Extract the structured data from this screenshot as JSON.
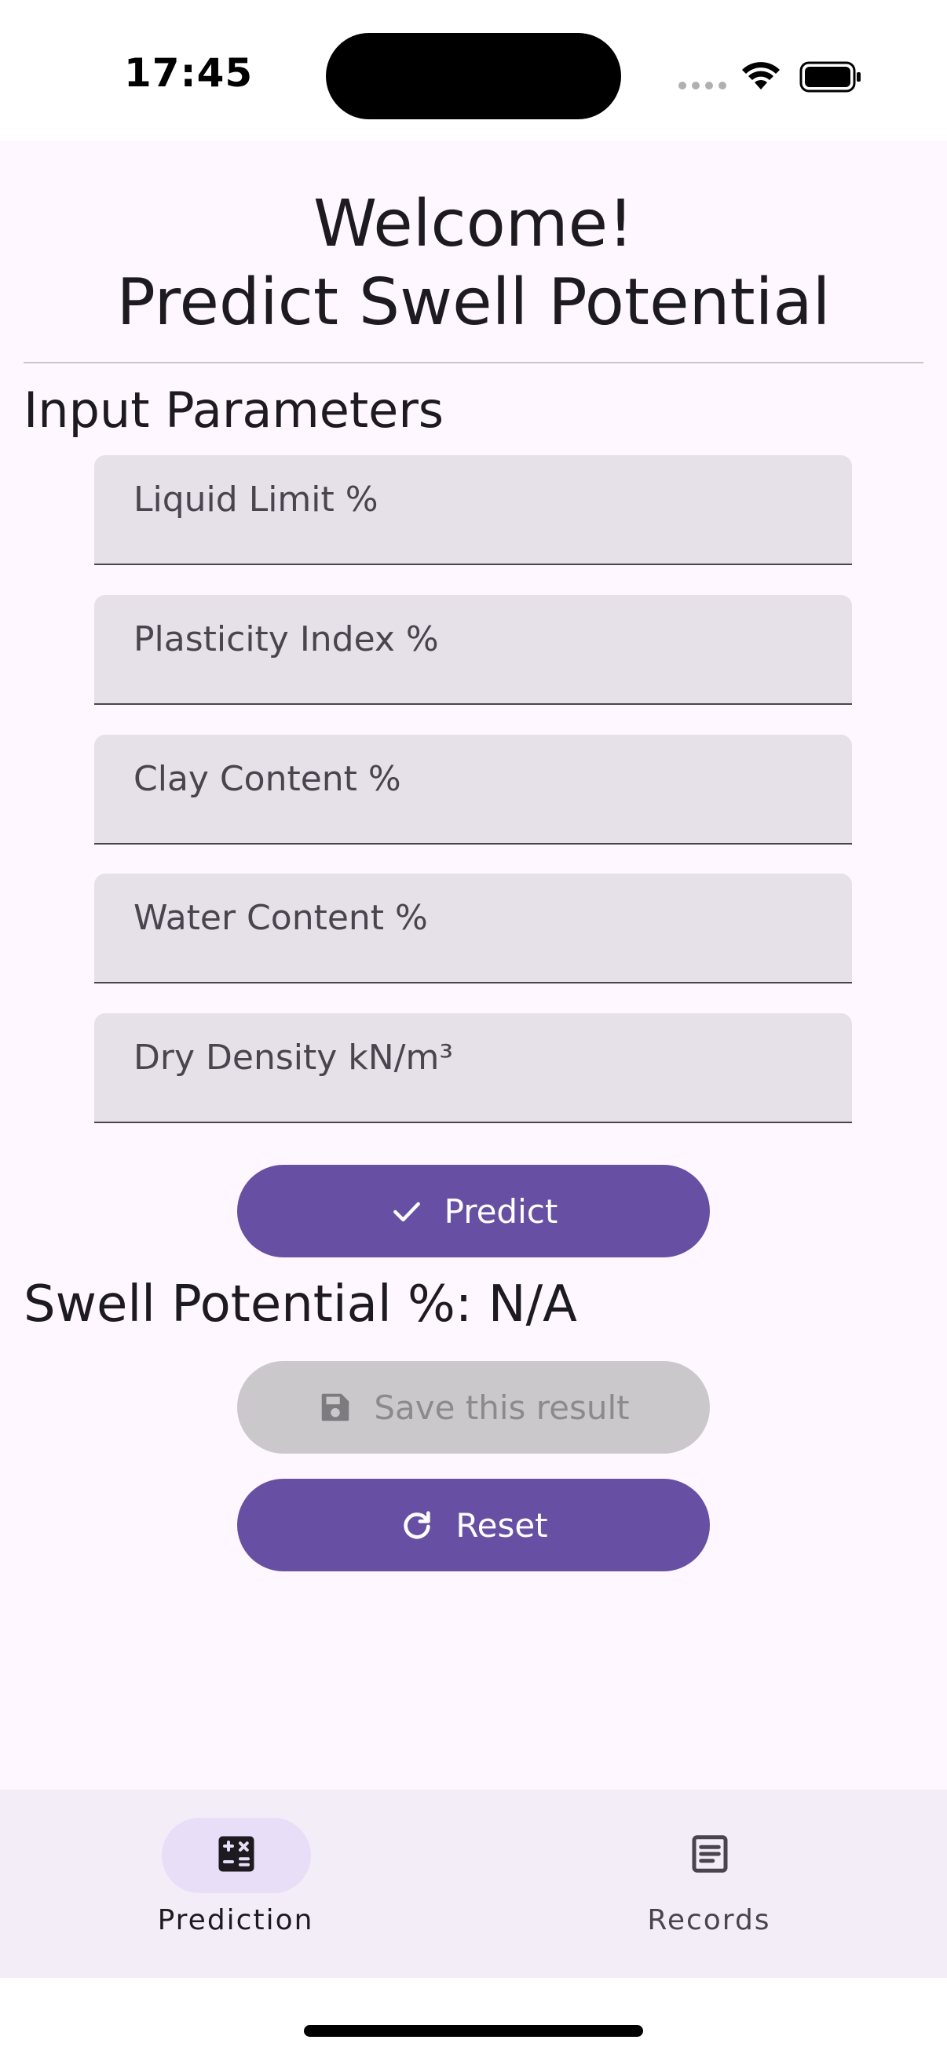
{
  "status_bar": {
    "time": "17:45",
    "icons": [
      "signal-icon",
      "wifi-icon",
      "battery-icon"
    ]
  },
  "header": {
    "welcome_line": "Welcome!",
    "title_line": "Predict Swell Potential"
  },
  "section_title": "Input Parameters",
  "inputs": [
    {
      "placeholder": "Liquid Limit %",
      "value": ""
    },
    {
      "placeholder": "Plasticity Index %",
      "value": ""
    },
    {
      "placeholder": "Clay Content %",
      "value": ""
    },
    {
      "placeholder": "Water Content %",
      "value": ""
    },
    {
      "placeholder": "Dry Density kN/m³",
      "value": ""
    }
  ],
  "buttons": {
    "predict": {
      "label": "Predict",
      "icon": "check-icon"
    },
    "save": {
      "label": "Save this result",
      "icon": "save-icon",
      "disabled": true
    },
    "reset": {
      "label": "Reset",
      "icon": "refresh-icon"
    }
  },
  "result": {
    "text": "Swell Potential %: N/A"
  },
  "bottom_nav": {
    "items": [
      {
        "label": "Prediction",
        "icon": "calculator-icon",
        "active": true
      },
      {
        "label": "Records",
        "icon": "document-icon",
        "active": false
      }
    ]
  },
  "colors": {
    "primary": "#6750a4",
    "surface": "#fef7ff",
    "field_fill": "#e6e0e9",
    "nav_background": "#f3edf7",
    "active_indicator": "#e8def8",
    "disabled_button": "#cac8cb"
  }
}
